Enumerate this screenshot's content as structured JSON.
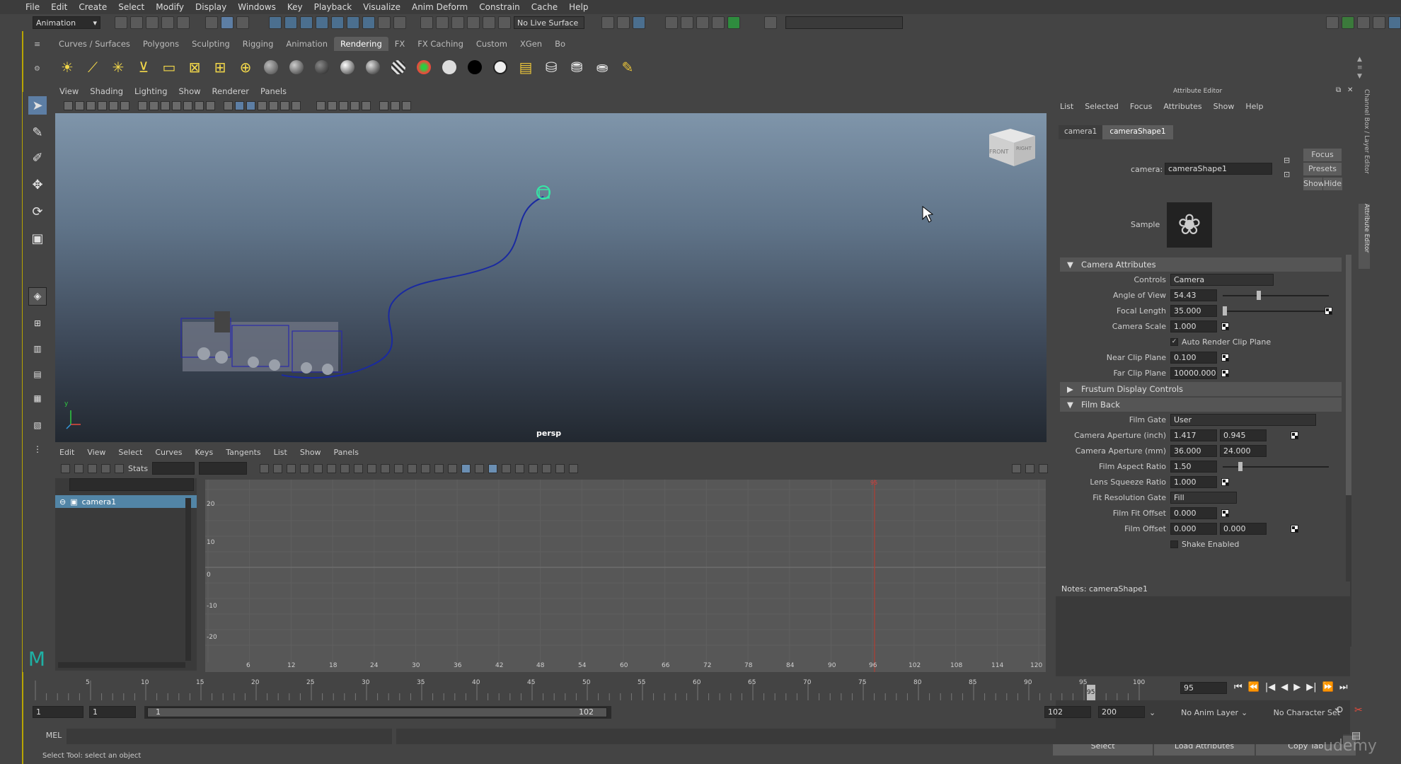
{
  "menubar": [
    "File",
    "Edit",
    "Modify",
    "Create",
    "Select",
    "Display",
    "Windows",
    "Key",
    "Playback",
    "Visualize",
    "Anim Deform",
    "Constrain",
    "Cache",
    "Help"
  ],
  "menubar_labels": {
    "m0": "File",
    "m1": "Edit",
    "m2": "Create",
    "m3": "Select",
    "m4": "Modify",
    "m5": "Display",
    "m6": "Windows",
    "m7": "Key",
    "m8": "Playback",
    "m9": "Visualize",
    "m10": "Anim Deform",
    "m11": "Constrain",
    "m12": "Cache",
    "m13": "Help"
  },
  "status": {
    "mode": "Animation",
    "live_surface": "No Live Surface"
  },
  "shelf_tabs": {
    "t0": "Curves / Surfaces",
    "t1": "Polygons",
    "t2": "Sculpting",
    "t3": "Rigging",
    "t4": "Animation",
    "t5": "Rendering",
    "t6": "FX",
    "t7": "FX Caching",
    "t8": "Custom",
    "t9": "XGen",
    "t10": "Bo"
  },
  "viewport": {
    "menu": {
      "v0": "View",
      "v1": "Shading",
      "v2": "Lighting",
      "v3": "Show",
      "v4": "Renderer",
      "v5": "Panels"
    },
    "camera_label": "persp",
    "cube_front": "FRONT",
    "cube_right": "RIGHT",
    "axis_y": "y"
  },
  "graph": {
    "menu": {
      "g0": "Edit",
      "g1": "View",
      "g2": "Select",
      "g3": "Curves",
      "g4": "Keys",
      "g5": "Tangents",
      "g6": "List",
      "g7": "Show",
      "g8": "Panels"
    },
    "stats": "Stats",
    "outliner_item": "camera1",
    "y_ticks": {
      "y0": "20",
      "y1": "10",
      "y2": "0",
      "y3": "-10",
      "y4": "-20"
    },
    "x_ticks": {
      "x0": "6",
      "x1": "12",
      "x2": "18",
      "x3": "24",
      "x4": "30",
      "x5": "36",
      "x6": "42",
      "x7": "48",
      "x8": "54",
      "x9": "60",
      "x10": "66",
      "x11": "72",
      "x12": "78",
      "x13": "84",
      "x14": "90",
      "x15": "96",
      "x16": "102",
      "x17": "108",
      "x18": "114",
      "x19": "120"
    },
    "current_frame_mark": "95"
  },
  "attribute_editor": {
    "title": "Attribute Editor",
    "menu": {
      "a0": "List",
      "a1": "Selected",
      "a2": "Focus",
      "a3": "Attributes",
      "a4": "Show",
      "a5": "Help"
    },
    "tabs": {
      "tab0": "camera1",
      "tab1": "cameraShape1"
    },
    "focus": "Focus",
    "presets": "Presets",
    "show": "Show",
    "hide": "Hide",
    "camera_label": "camera:",
    "camera_value": "cameraShape1",
    "sample": "Sample",
    "sections": {
      "s0": "Camera Attributes",
      "s1": "Frustum Display Controls",
      "s2": "Film Back"
    },
    "controls_label": "Controls",
    "controls_value": "Camera",
    "angle_label": "Angle of View",
    "angle": "54.43",
    "focal_label": "Focal Length",
    "focal": "35.000",
    "scale_label": "Camera Scale",
    "scale": "1.000",
    "auto_clip": "Auto Render Clip Plane",
    "near_label": "Near Clip Plane",
    "near": "0.100",
    "far_label": "Far Clip Plane",
    "far": "10000.000",
    "filmgate_label": "Film Gate",
    "filmgate": "User",
    "ap_inch_label": "Camera Aperture (inch)",
    "ap_inch_w": "1.417",
    "ap_inch_h": "0.945",
    "ap_mm_label": "Camera Aperture (mm)",
    "ap_mm_w": "36.000",
    "ap_mm_h": "24.000",
    "aspect_label": "Film Aspect Ratio",
    "aspect": "1.50",
    "squeeze_label": "Lens Squeeze Ratio",
    "squeeze": "1.000",
    "fitgate_label": "Fit Resolution Gate",
    "fitgate": "Fill",
    "fitoffset_label": "Film Fit Offset",
    "fitoffset": "0.000",
    "filmoffset_label": "Film Offset",
    "filmoffset_x": "0.000",
    "filmoffset_y": "0.000",
    "shake": "Shake Enabled",
    "notes": "Notes:  cameraShape1",
    "btn_select": "Select",
    "btn_load": "Load Attributes",
    "btn_copy": "Copy Tab",
    "side_tab1": "Channel Box / Layer Editor",
    "side_tab2": "Attribute Editor"
  },
  "timeline": {
    "ticks": {
      "k0": "5",
      "k1": "10",
      "k2": "15",
      "k3": "20",
      "k4": "25",
      "k5": "30",
      "k6": "35",
      "k7": "40",
      "k8": "45",
      "k9": "50",
      "k10": "55",
      "k11": "60",
      "k12": "65",
      "k13": "70",
      "k14": "75",
      "k15": "80",
      "k16": "85",
      "k17": "90",
      "k18": "95",
      "k19": "100"
    },
    "current": "95",
    "current_mark": "95"
  },
  "range": {
    "start": "1",
    "start2": "1",
    "range_start": "1",
    "range_end": "102",
    "end": "102",
    "end2": "200",
    "anim_layer": "No Anim Layer",
    "char_set": "No Character Set"
  },
  "command": {
    "lang": "MEL"
  },
  "help_line": "Select Tool: select an object",
  "watermark": "udemy",
  "colors": {
    "accent": "#5d7ea4",
    "timeline_marker": "#c0392b",
    "curve": "#1a2aa0",
    "selected_row": "#5285a6"
  }
}
